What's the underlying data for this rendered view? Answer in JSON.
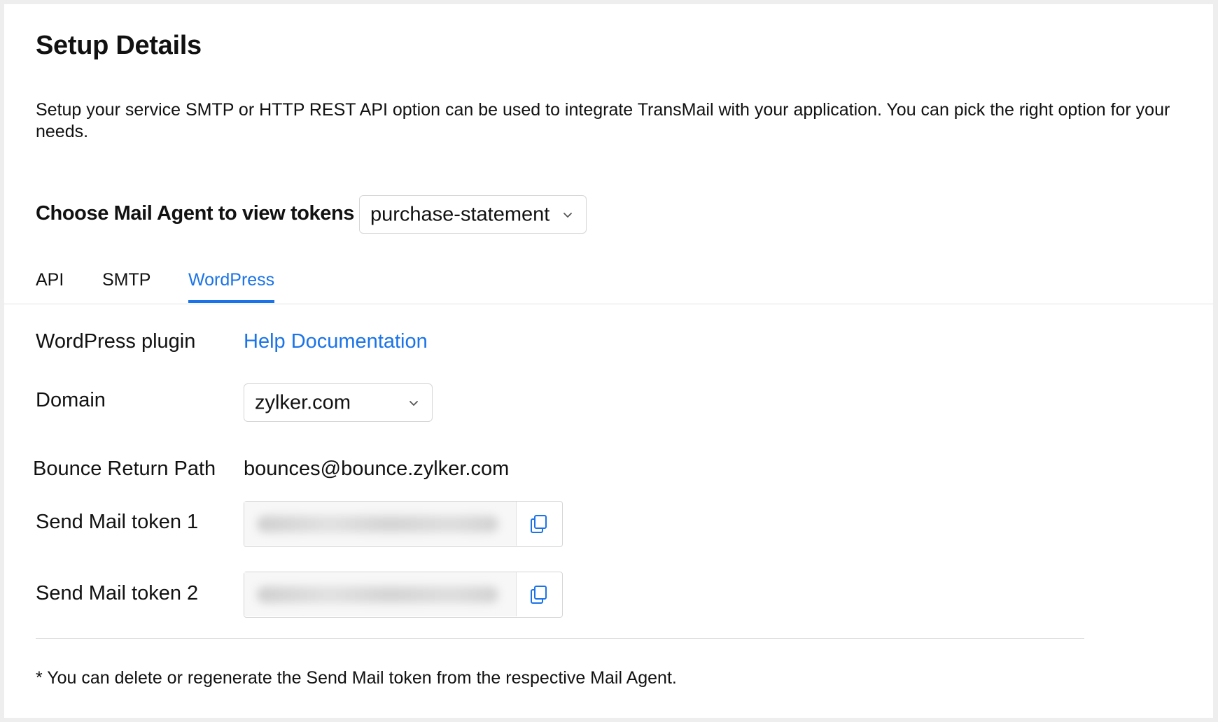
{
  "page": {
    "title": "Setup Details",
    "description": "Setup your service SMTP or HTTP REST API option can be used to integrate TransMail with your application. You can pick the right option for your needs."
  },
  "agent": {
    "label": "Choose Mail Agent to view tokens",
    "selected": "purchase-statement"
  },
  "tabs": [
    {
      "label": "API",
      "active": false
    },
    {
      "label": "SMTP",
      "active": false
    },
    {
      "label": "WordPress",
      "active": true
    }
  ],
  "wordpress": {
    "plugin_label": "WordPress plugin",
    "help_link": "Help Documentation",
    "domain_label": "Domain",
    "domain_selected": "zylker.com",
    "bounce_label": "Bounce Return Path",
    "bounce_value": "bounces@bounce.zylker.com",
    "tokens": [
      {
        "label": "Send Mail token 1",
        "value_hidden": true,
        "copy_icon": "copy-icon"
      },
      {
        "label": "Send Mail token 2",
        "value_hidden": true,
        "copy_icon": "copy-icon"
      }
    ]
  },
  "footnote": "* You can delete or regenerate the Send Mail token from the respective Mail Agent.",
  "colors": {
    "accent": "#1a73e8",
    "text": "#111111",
    "border": "#d6d6d6",
    "background": "#eeeeee",
    "panel": "#ffffff"
  }
}
